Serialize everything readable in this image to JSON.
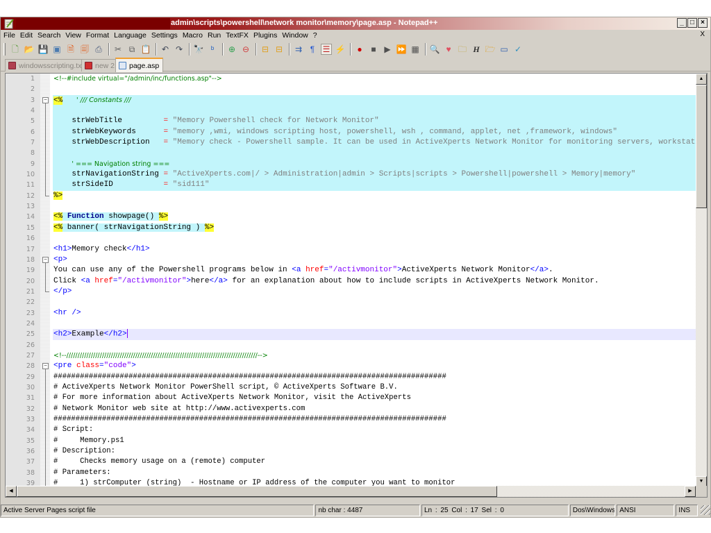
{
  "window": {
    "title": "admin\\scripts\\powershell\\network monitor\\memory\\page.asp - Notepad++",
    "controls": [
      "_",
      "□",
      "×"
    ]
  },
  "menu": {
    "items": [
      "File",
      "Edit",
      "Search",
      "View",
      "Format",
      "Language",
      "Settings",
      "Macro",
      "Run",
      "TextFX",
      "Plugins",
      "Window",
      "?"
    ],
    "close_label": "X"
  },
  "toolbar": {
    "buttons": [
      {
        "name": "new-file-icon",
        "glyph": "🗋",
        "color": "#5a9a3a"
      },
      {
        "name": "open-file-icon",
        "glyph": "📂",
        "color": "#e0a030"
      },
      {
        "name": "save-icon",
        "glyph": "💾",
        "color": "#505050"
      },
      {
        "name": "save-all-icon",
        "glyph": "▣",
        "color": "#4a7ab0"
      },
      {
        "name": "close-file-icon",
        "glyph": "🗎",
        "color": "#e06020"
      },
      {
        "name": "close-all-icon",
        "glyph": "🗐",
        "color": "#e06020"
      },
      {
        "name": "print-icon",
        "glyph": "⎙",
        "color": "#506080"
      },
      {
        "sep": true
      },
      {
        "name": "cut-icon",
        "glyph": "✂",
        "color": "#606060"
      },
      {
        "name": "copy-icon",
        "glyph": "⧉",
        "color": "#606060"
      },
      {
        "name": "paste-icon",
        "glyph": "📋",
        "color": "#c09040"
      },
      {
        "sep": true
      },
      {
        "name": "undo-icon",
        "glyph": "↶",
        "color": "#404858"
      },
      {
        "name": "redo-icon",
        "glyph": "↷",
        "color": "#404858"
      },
      {
        "sep": true
      },
      {
        "name": "find-icon",
        "glyph": "🔭",
        "color": "#404040"
      },
      {
        "name": "replace-icon",
        "glyph": "ᵇ",
        "color": "#2060c0"
      },
      {
        "sep": true
      },
      {
        "name": "zoom-in-icon",
        "glyph": "⊕",
        "color": "#30a050"
      },
      {
        "name": "zoom-out-icon",
        "glyph": "⊖",
        "color": "#d04040"
      },
      {
        "sep": true
      },
      {
        "name": "sync-vertical-icon",
        "glyph": "⊟",
        "color": "#e0a020"
      },
      {
        "name": "sync-horizontal-icon",
        "glyph": "⊟",
        "color": "#e0a020"
      },
      {
        "sep": true
      },
      {
        "name": "word-wrap-icon",
        "glyph": "⇉",
        "color": "#3060b0"
      },
      {
        "name": "show-all-chars-icon",
        "glyph": "¶",
        "color": "#3060d0"
      },
      {
        "name": "indent-guide-icon",
        "glyph": "☰",
        "color": "#c02020",
        "pressed": true
      },
      {
        "name": "user-lang-icon",
        "glyph": "⚡",
        "color": "#e0a020"
      },
      {
        "sep": true
      },
      {
        "name": "record-macro-icon",
        "glyph": "●",
        "color": "#d00000"
      },
      {
        "name": "stop-macro-icon",
        "glyph": "■",
        "color": "#505050"
      },
      {
        "name": "play-macro-icon",
        "glyph": "▶",
        "color": "#505050"
      },
      {
        "name": "run-macro-multiple-icon",
        "glyph": "⏩",
        "color": "#4060c0"
      },
      {
        "name": "save-macro-icon",
        "glyph": "▦",
        "color": "#505050"
      },
      {
        "sep": true
      },
      {
        "name": "find-in-files-icon",
        "glyph": "🔍",
        "color": "#e0a020"
      },
      {
        "name": "favorites-icon",
        "glyph": "♥",
        "color": "#e05060"
      },
      {
        "name": "folder-binoculars-icon",
        "glyph": "🗀",
        "color": "#c0a030"
      },
      {
        "name": "header-icon",
        "glyph": "H",
        "color": "#303030"
      },
      {
        "name": "explorer-icon",
        "glyph": "🗁",
        "color": "#e0a020"
      },
      {
        "name": "console-icon",
        "glyph": "▭",
        "color": "#3060b0"
      },
      {
        "name": "spell-check-icon",
        "glyph": "✓",
        "color": "#3090c0"
      }
    ]
  },
  "tabs": [
    {
      "label": "windowsscripting.txt",
      "icon_color": "#b04050",
      "active": false
    },
    {
      "label": "new 2",
      "icon_color": "#d03030",
      "active": false
    },
    {
      "label": "page.asp",
      "icon_color": "#4a80c0",
      "active": true
    }
  ],
  "editor": {
    "current_line": 25,
    "lines": [
      {
        "n": "1",
        "segs": [
          [
            "comment-html",
            "<!--#include virtual=\"/admin/inc/functions.asp\"-->"
          ]
        ]
      },
      {
        "n": "2",
        "segs": []
      },
      {
        "n": "3",
        "fold": "start",
        "bg": "asp",
        "segs": [
          [
            "delim",
            "<%"
          ],
          [
            "txt",
            "   "
          ],
          [
            "comment-asp",
            "' /// Constants ///"
          ]
        ]
      },
      {
        "n": "4",
        "fold": "line",
        "bg": "asp",
        "segs": []
      },
      {
        "n": "5",
        "fold": "line",
        "bg": "asp",
        "segs": [
          [
            "txt",
            "    "
          ],
          [
            "var",
            "strWebTitle         "
          ],
          [
            "op",
            "="
          ],
          [
            "txt",
            " "
          ],
          [
            "str",
            "\"Memory Powershell check for Network Monitor\""
          ]
        ]
      },
      {
        "n": "6",
        "fold": "line",
        "bg": "asp",
        "segs": [
          [
            "txt",
            "    "
          ],
          [
            "var",
            "strWebKeywords      "
          ],
          [
            "op",
            "="
          ],
          [
            "txt",
            " "
          ],
          [
            "str",
            "\"memory ,wmi, windows scripting host, powershell, wsh , command, applet, net ,framework, windows\""
          ]
        ]
      },
      {
        "n": "7",
        "fold": "line",
        "bg": "asp",
        "segs": [
          [
            "txt",
            "    "
          ],
          [
            "var",
            "strWebDescription   "
          ],
          [
            "op",
            "="
          ],
          [
            "txt",
            " "
          ],
          [
            "str",
            "\"Memory check - Powershell sample. It can be used in ActiveXperts Network Monitor for monitoring servers, workstations\""
          ]
        ]
      },
      {
        "n": "8",
        "fold": "line",
        "bg": "asp",
        "segs": []
      },
      {
        "n": "9",
        "fold": "line",
        "bg": "asp",
        "segs": [
          [
            "txt",
            "    "
          ],
          [
            "comment-asp-plain",
            "' === Navigation string ==="
          ]
        ]
      },
      {
        "n": "10",
        "fold": "line",
        "bg": "asp",
        "segs": [
          [
            "txt",
            "    "
          ],
          [
            "var",
            "strNavigationString "
          ],
          [
            "op",
            "="
          ],
          [
            "txt",
            " "
          ],
          [
            "str",
            "\"ActiveXperts.com|/ > Administration|admin > Scripts|scripts > Powershell|powershell > Memory|memory\""
          ]
        ]
      },
      {
        "n": "11",
        "fold": "line",
        "bg": "asp",
        "segs": [
          [
            "txt",
            "    "
          ],
          [
            "var",
            "strSideID           "
          ],
          [
            "op",
            "="
          ],
          [
            "txt",
            " "
          ],
          [
            "str",
            "\"sid111\""
          ]
        ]
      },
      {
        "n": "12",
        "fold": "end",
        "segs": [
          [
            "delim",
            "%>"
          ]
        ]
      },
      {
        "n": "13",
        "segs": []
      },
      {
        "n": "14",
        "segs": [
          [
            "delim",
            "<%"
          ],
          [
            "asp",
            " "
          ],
          [
            "kw",
            "Function"
          ],
          [
            "asp",
            " showpage() "
          ],
          [
            "delim",
            "%>"
          ]
        ]
      },
      {
        "n": "15",
        "segs": [
          [
            "delim",
            "<%"
          ],
          [
            "asp",
            " banner( strNavigationString ) "
          ],
          [
            "delim",
            "%>"
          ]
        ]
      },
      {
        "n": "16",
        "segs": []
      },
      {
        "n": "17",
        "segs": [
          [
            "tag",
            "<h1>"
          ],
          [
            "txt",
            "Memory check"
          ],
          [
            "tag",
            "</h1>"
          ]
        ]
      },
      {
        "n": "18",
        "fold": "start",
        "segs": [
          [
            "tag",
            "<p>"
          ]
        ]
      },
      {
        "n": "19",
        "fold": "line",
        "segs": [
          [
            "txt",
            "You can use any of the Powershell programs below in "
          ],
          [
            "tag",
            "<a "
          ],
          [
            "attr",
            "href"
          ],
          [
            "tag",
            "="
          ],
          [
            "attrval",
            "\"/activmonitor\""
          ],
          [
            "tag",
            ">"
          ],
          [
            "txt",
            "ActiveXperts Network Monitor"
          ],
          [
            "tag",
            "</a>"
          ],
          [
            "txt",
            "."
          ]
        ]
      },
      {
        "n": "20",
        "fold": "line",
        "segs": [
          [
            "txt",
            "Click "
          ],
          [
            "tag",
            "<a "
          ],
          [
            "attr",
            "href"
          ],
          [
            "tag",
            "="
          ],
          [
            "attrval",
            "\"/activmonitor\""
          ],
          [
            "tag",
            ">"
          ],
          [
            "txt",
            "here"
          ],
          [
            "tag",
            "</a>"
          ],
          [
            "txt",
            " for an explanation about how to include scripts in ActiveXperts Network Monitor."
          ]
        ]
      },
      {
        "n": "21",
        "fold": "end",
        "segs": [
          [
            "tag",
            "</p>"
          ]
        ]
      },
      {
        "n": "22",
        "segs": []
      },
      {
        "n": "23",
        "segs": [
          [
            "tag",
            "<hr />"
          ]
        ]
      },
      {
        "n": "24",
        "segs": []
      },
      {
        "n": "25",
        "segs": [
          [
            "tag",
            "<h2>"
          ],
          [
            "txt",
            "Example"
          ],
          [
            "tag",
            "</h2>"
          ],
          [
            "caret",
            ""
          ]
        ]
      },
      {
        "n": "26",
        "segs": []
      },
      {
        "n": "27",
        "segs": [
          [
            "comment-html",
            "<!--//////////////////////////////////////////////////////////////////////////////////////-->"
          ]
        ]
      },
      {
        "n": "28",
        "fold": "start",
        "segs": [
          [
            "tag",
            "<pre "
          ],
          [
            "attr",
            "class"
          ],
          [
            "tag",
            "="
          ],
          [
            "attrval",
            "\"code\""
          ],
          [
            "tag",
            ">"
          ]
        ]
      },
      {
        "n": "29",
        "fold": "line",
        "segs": [
          [
            "pre",
            "#########################################################################################"
          ]
        ]
      },
      {
        "n": "30",
        "fold": "line",
        "segs": [
          [
            "pre",
            "# ActiveXperts Network Monitor PowerShell script, © ActiveXperts Software B.V."
          ]
        ]
      },
      {
        "n": "31",
        "fold": "line",
        "segs": [
          [
            "pre",
            "# For more information about ActiveXperts Network Monitor, visit the ActiveXperts"
          ]
        ]
      },
      {
        "n": "32",
        "fold": "line",
        "segs": [
          [
            "pre",
            "# Network Monitor web site at http://www.activexperts.com"
          ]
        ]
      },
      {
        "n": "33",
        "fold": "line",
        "segs": [
          [
            "pre",
            "#########################################################################################"
          ]
        ]
      },
      {
        "n": "34",
        "fold": "line",
        "segs": [
          [
            "pre",
            "# Script:"
          ]
        ]
      },
      {
        "n": "35",
        "fold": "line",
        "segs": [
          [
            "pre",
            "#     Memory.ps1"
          ]
        ]
      },
      {
        "n": "36",
        "fold": "line",
        "segs": [
          [
            "pre",
            "# Description:"
          ]
        ]
      },
      {
        "n": "37",
        "fold": "line",
        "segs": [
          [
            "pre",
            "#     Checks memory usage on a (remote) computer"
          ]
        ]
      },
      {
        "n": "38",
        "fold": "line",
        "segs": [
          [
            "pre",
            "# Parameters:"
          ]
        ]
      },
      {
        "n": "39",
        "fold": "line",
        "segs": [
          [
            "pre",
            "#     1) strComputer (string)  - Hostname or IP address of the computer you want to monitor"
          ]
        ]
      }
    ]
  },
  "status": {
    "file_type": "Active Server Pages script file",
    "nb_char": "nb char : 4487",
    "position": "Ln : 25    Col : 17    Sel : 0",
    "eol": "Dos\\Windows",
    "encoding": "ANSI",
    "mode": "INS"
  }
}
